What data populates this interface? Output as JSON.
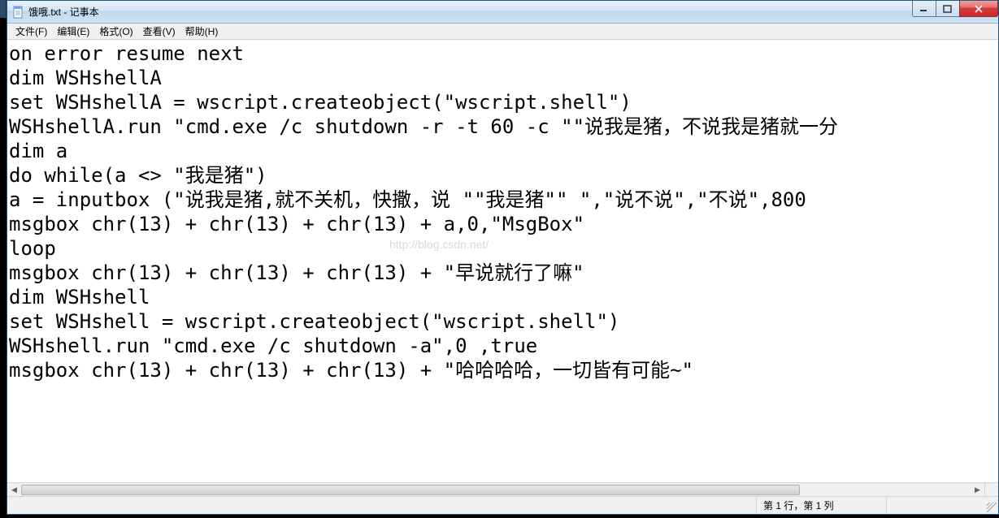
{
  "window": {
    "title": "饿哦.txt - 记事本"
  },
  "menu": {
    "file": "文件(F)",
    "edit": "编辑(E)",
    "format": "格式(O)",
    "view": "查看(V)",
    "help": "帮助(H)"
  },
  "editor": {
    "lines": [
      "on error resume next",
      "dim WSHshellA",
      "set WSHshellA = wscript.createobject(\"wscript.shell\")",
      "WSHshellA.run \"cmd.exe /c shutdown -r -t 60 -c \"\"说我是猪，不说我是猪就一分",
      "dim a",
      "do while(a <> \"我是猪\")",
      "a = inputbox (\"说我是猪,就不关机，快撒，说 \"\"我是猪\"\" \",\"说不说\",\"不说\",800",
      "msgbox chr(13) + chr(13) + chr(13) + a,0,\"MsgBox\"",
      "loop",
      "msgbox chr(13) + chr(13) + chr(13) + \"早说就行了嘛\"",
      "dim WSHshell",
      "set WSHshell = wscript.createobject(\"wscript.shell\")",
      "WSHshell.run \"cmd.exe /c shutdown -a\",0 ,true",
      "msgbox chr(13) + chr(13) + chr(13) + \"哈哈哈哈，一切皆有可能~\""
    ]
  },
  "watermark": "http://blog.csdn.net/",
  "status": {
    "position": "第 1 行，第 1 列"
  }
}
